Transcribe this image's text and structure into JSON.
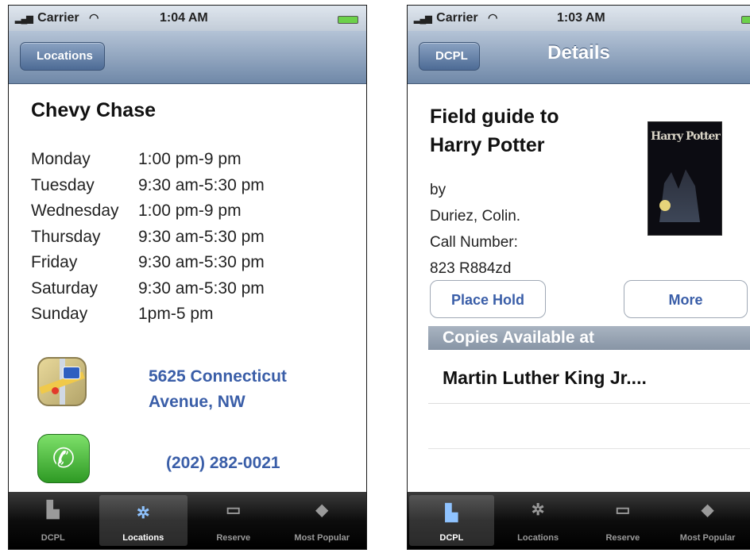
{
  "left": {
    "status": {
      "carrier": "Carrier",
      "time": "1:04 AM"
    },
    "nav": {
      "back": "Locations"
    },
    "branch_name": "Chevy Chase",
    "hours": [
      {
        "day": "Monday",
        "time": "1:00 pm-9 pm"
      },
      {
        "day": "Tuesday",
        "time": "9:30 am-5:30 pm"
      },
      {
        "day": "Wednesday",
        "time": "1:00 pm-9 pm"
      },
      {
        "day": "Thursday",
        "time": "9:30 am-5:30 pm"
      },
      {
        "day": "Friday",
        "time": "9:30 am-5:30 pm"
      },
      {
        "day": "Saturday",
        "time": "9:30 am-5:30 pm"
      },
      {
        "day": "Sunday",
        "time": "1pm-5 pm"
      }
    ],
    "address_line1": "5625 Connecticut",
    "address_line2": "Avenue, NW",
    "phone": "(202) 282-0021",
    "tabs": [
      "DCPL",
      "Locations",
      "Reserve",
      "Most Popular"
    ],
    "selected_tab": "Locations"
  },
  "right": {
    "status": {
      "carrier": "Carrier",
      "time": "1:03 AM"
    },
    "nav": {
      "back": "DCPL",
      "title": "Details"
    },
    "book_title_line1": "Field guide to",
    "book_title_line2": "Harry Potter",
    "cover_text": "Harry Potter",
    "by": "by",
    "author": "Duriez, Colin.",
    "call_label": "Call Number:",
    "call_number": "823 R884zd",
    "place_hold": "Place Hold",
    "more": "More",
    "section_header": "Copies Available at",
    "location": "Martin Luther King Jr....",
    "tabs": [
      "DCPL",
      "Locations",
      "Reserve",
      "Most Popular"
    ],
    "selected_tab": "DCPL"
  },
  "icons": {
    "signal": "signal-bars-icon",
    "wifi": "wifi-icon",
    "battery": "battery-icon",
    "maps": "maps-icon",
    "phone": "phone-icon",
    "dcpl": "library-book-icon",
    "locations": "globe-icon",
    "reserve": "monitor-icon",
    "popular": "tag-icon"
  },
  "colors": {
    "link": "#3a5ea8",
    "nav": "#6f88a8",
    "phone_green": "#2e9a24"
  }
}
